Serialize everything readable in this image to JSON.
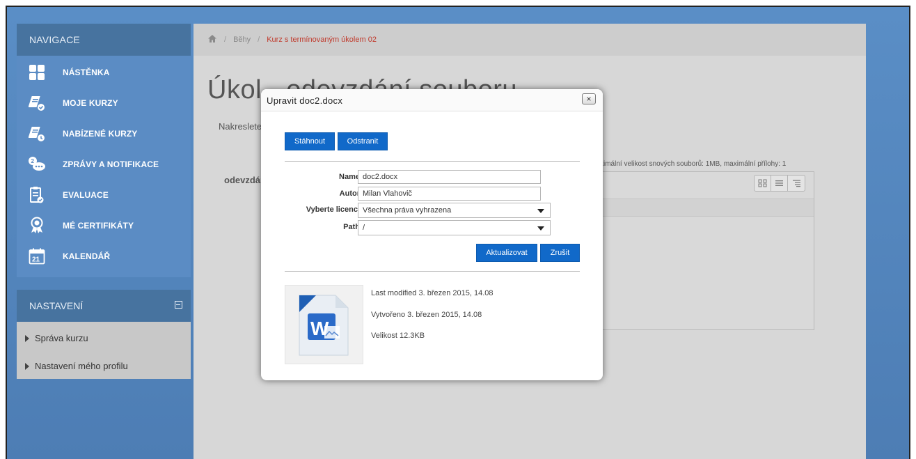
{
  "navigation": {
    "header": "NAVIGACE",
    "items": [
      {
        "label": "NÁSTĚNKA",
        "icon": "dashboard-icon"
      },
      {
        "label": "MOJE KURZY",
        "icon": "my-courses-icon"
      },
      {
        "label": "NABÍZENÉ KURZY",
        "icon": "offered-courses-icon"
      },
      {
        "label": "ZPRÁVY A NOTIFIKACE",
        "icon": "messages-icon"
      },
      {
        "label": "EVALUACE",
        "icon": "evaluation-icon"
      },
      {
        "label": "MÉ CERTIFIKÁTY",
        "icon": "certificate-icon"
      },
      {
        "label": "KALENDÁŘ",
        "icon": "calendar-icon",
        "day": "21"
      }
    ]
  },
  "settings": {
    "header": "NASTAVENÍ",
    "links": [
      "Správa kurzu",
      "Nastavení mého profilu"
    ]
  },
  "breadcrumb": {
    "home_icon": "home-icon",
    "items": [
      "Běhy",
      "Kurz s termínovaným úkolem 02"
    ]
  },
  "page": {
    "title": "Úkol - odevzdání souboru",
    "intro": "Nakreslete",
    "submission_label": "odevzdání",
    "limits": "ximální velikost snových souborů: 1MB, maximální přílohy: 1"
  },
  "modal": {
    "title": "Upravit doc2.docx",
    "close_label": "×",
    "download_label": "Stáhnout",
    "delete_label": "Odstranit",
    "fields": {
      "name_label": "Name",
      "name_value": "doc2.docx",
      "author_label": "Autor",
      "author_value": "Milan Vlahovič",
      "license_label": "Vyberte licenci",
      "license_value": "Všechna práva vyhrazena",
      "path_label": "Path",
      "path_value": "/"
    },
    "update_label": "Aktualizovat",
    "cancel_label": "Zrušit",
    "file_icon": "word-document-icon",
    "last_modified": "Last modified 3. březen 2015, 14.08",
    "created": "Vytvořeno 3. březen 2015, 14.08",
    "size": "Velikost 12.3KB"
  },
  "colors": {
    "sidebar": "#5b8cc4",
    "sidebar_header": "#47739f",
    "primary_button": "#1169c9",
    "breadcrumb_active": "#c0392b"
  }
}
